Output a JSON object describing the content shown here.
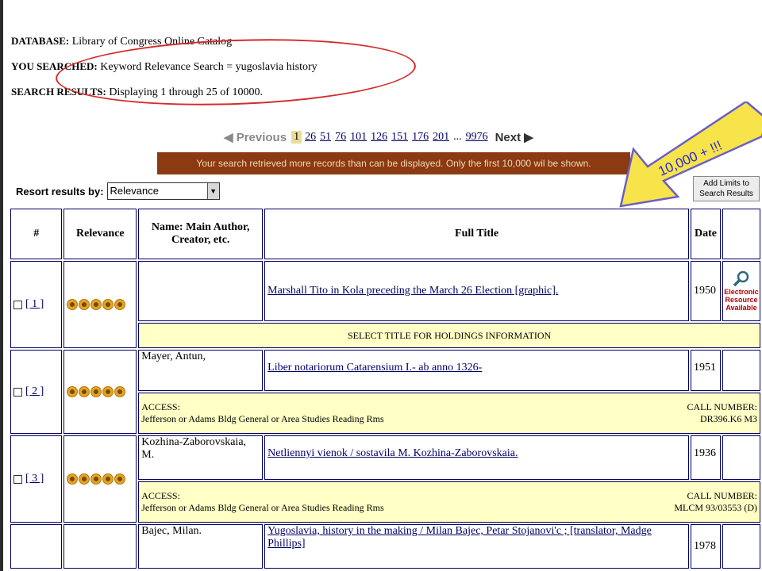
{
  "summary": {
    "database_label": "DATABASE:",
    "database_value": "Library of Congress Online Catalog",
    "searched_label": "YOU SEARCHED:",
    "searched_value": "Keyword Relevance Search = yugoslavia history",
    "results_label": "SEARCH RESULTS:",
    "results_value": "Displaying 1 through 25 of 10000."
  },
  "pager": {
    "previous": "Previous",
    "current": "1",
    "pages": [
      "26",
      "51",
      "76",
      "101",
      "126",
      "151",
      "176",
      "201"
    ],
    "ellipsis": "...",
    "last": "9976",
    "next": "Next"
  },
  "banner": "Your search retrieved more records than can be displayed. Only the first 10,000 wil be shown.",
  "resort": {
    "label": "Resort results by:",
    "selected": "Relevance"
  },
  "add_limits": {
    "line1": "Add Limits to",
    "line2": "Search Results"
  },
  "callout": {
    "text": "10,000 + !!!",
    "color": "#f7e34a"
  },
  "table": {
    "headers": {
      "num": "#",
      "relevance": "Relevance",
      "name": "Name: Main Author, Creator, etc.",
      "title": "Full Title",
      "date": "Date"
    },
    "rows": [
      {
        "num": "[ 1 ]",
        "name": "",
        "title": "Marshall Tito in Kola preceding the March 26 Election [graphic].",
        "date": "1950",
        "info": "SELECT TITLE FOR HOLDINGS INFORMATION",
        "er": [
          "Electronic",
          "Resource",
          "Available"
        ]
      },
      {
        "num": "[ 2 ]",
        "name": "Mayer, Antun,",
        "title": "Liber notariorum Catarensium I.- ab anno 1326-",
        "date": "1951",
        "access_label": "ACCESS:",
        "access_value": "Jefferson or Adams Bldg General or Area Studies Reading Rms",
        "call_label": "CALL NUMBER:",
        "call_value": "DR396.K6 M3"
      },
      {
        "num": "[ 3 ]",
        "name": "Kozhina-Zaborovskaia, M.",
        "title": "Netliennyi vienok / sostavila M. Kozhina-Zaborovskaia.",
        "date": "1936",
        "access_label": "ACCESS:",
        "access_value": "Jefferson or Adams Bldg General or Area Studies Reading Rms",
        "call_label": "CALL NUMBER:",
        "call_value": "MLCM 93/03553 (D)"
      },
      {
        "num": "",
        "name": "Bajec, Milan.",
        "title": "Yugoslavia, history in the making / Milan Bajec, Petar Stojanovi'c ; [translator, Madge Phillips]",
        "date": "1978"
      }
    ]
  }
}
